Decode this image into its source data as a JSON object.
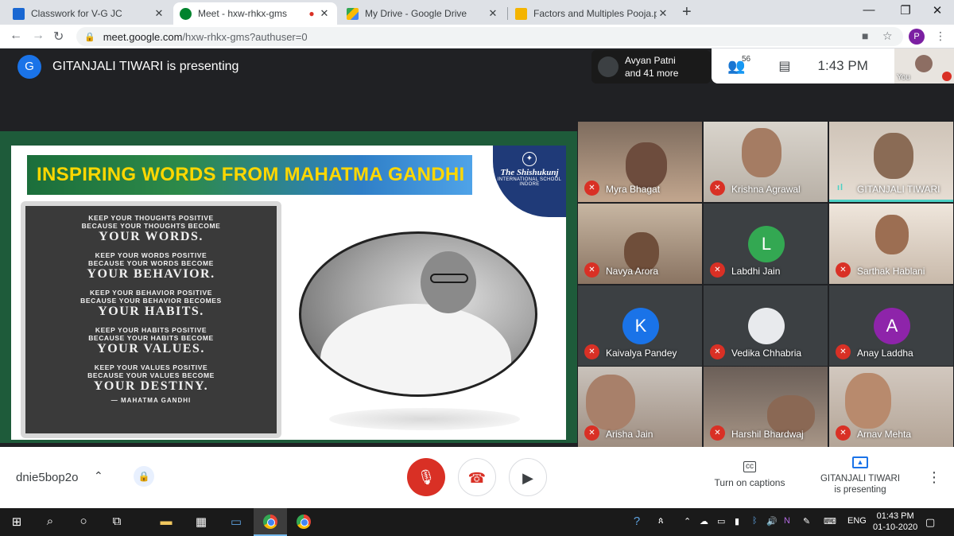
{
  "browser": {
    "tabs": [
      {
        "title": "Classwork for V-G JC",
        "favicon_color": "#1967d2"
      },
      {
        "title": "Meet - hxw-rhkx-gms",
        "favicon_color": "#00832d",
        "active": true
      },
      {
        "title": "My Drive - Google Drive",
        "favicon_color": "#fbbc04"
      },
      {
        "title": "Factors and Multiples Pooja.pptx",
        "favicon_color": "#f4b400"
      }
    ],
    "new_tab": "+",
    "url_host": "meet.google.com",
    "url_path": "/hxw-rhkx-gms?authuser=0",
    "profile_initial": "P"
  },
  "meet": {
    "presenter_initial": "G",
    "presenter_text": "GITANJALI TIWARI is presenting",
    "people_chip": {
      "line1": "Avyan Patni",
      "line2": "and 41 more"
    },
    "people_count": "56",
    "clock": "1:43 PM",
    "self_label": "You",
    "slide": {
      "title": "INSPIRING WORDS FROM MAHATMA GANDHI",
      "school_the": "The",
      "school_name": "Shishukunj",
      "school_sub": "INTERNATIONAL SCHOOL",
      "school_city": "INDORE",
      "quote": [
        {
          "small1": "KEEP YOUR THOUGHTS POSITIVE",
          "small2": "BECAUSE YOUR THOUGHTS BECOME",
          "big": "YOUR WORDS."
        },
        {
          "small1": "KEEP YOUR WORDS POSITIVE",
          "small2": "BECAUSE YOUR WORDS BECOME",
          "big": "YOUR BEHAVIOR."
        },
        {
          "small1": "KEEP YOUR BEHAVIOR POSITIVE",
          "small2": "BECAUSE YOUR BEHAVIOR BECOMES",
          "big": "YOUR HABITS."
        },
        {
          "small1": "KEEP YOUR HABITS POSITIVE",
          "small2": "BECAUSE YOUR HABITS BECOME",
          "big": "YOUR VALUES."
        },
        {
          "small1": "KEEP YOUR VALUES POSITIVE",
          "small2": "BECAUSE YOUR VALUES BECOME",
          "big": "YOUR DESTINY."
        }
      ],
      "author": "— MAHATMA GANDHI"
    },
    "participants": [
      {
        "name": "Myra Bhagat",
        "muted": true
      },
      {
        "name": "Krishna Agrawal",
        "muted": true
      },
      {
        "name": "GITANJALI TIWARI",
        "muted": false,
        "speaking": true
      },
      {
        "name": "Navya Arora",
        "muted": true
      },
      {
        "name": "Labdhi Jain",
        "muted": true,
        "initial": "L",
        "color": "#33a852"
      },
      {
        "name": "Sarthak Hablani",
        "muted": true
      },
      {
        "name": "Kaivalya Pandey",
        "muted": true,
        "initial": "K",
        "color": "#1a73e8"
      },
      {
        "name": "Vedika Chhabria",
        "muted": true
      },
      {
        "name": "Anay Laddha",
        "muted": true,
        "initial": "A",
        "color": "#8e24aa"
      },
      {
        "name": "Arisha Jain",
        "muted": true
      },
      {
        "name": "Harshil Bhardwaj",
        "muted": true
      },
      {
        "name": "Arnav Mehta",
        "muted": true
      }
    ]
  },
  "controls": {
    "meeting_code": "dnie5bop2o",
    "captions_label": "Turn on captions",
    "presenting_line1": "GITANJALI TIWARI",
    "presenting_line2": "is presenting"
  },
  "taskbar": {
    "lang": "ENG",
    "time": "01:43 PM",
    "date": "01-10-2020"
  }
}
